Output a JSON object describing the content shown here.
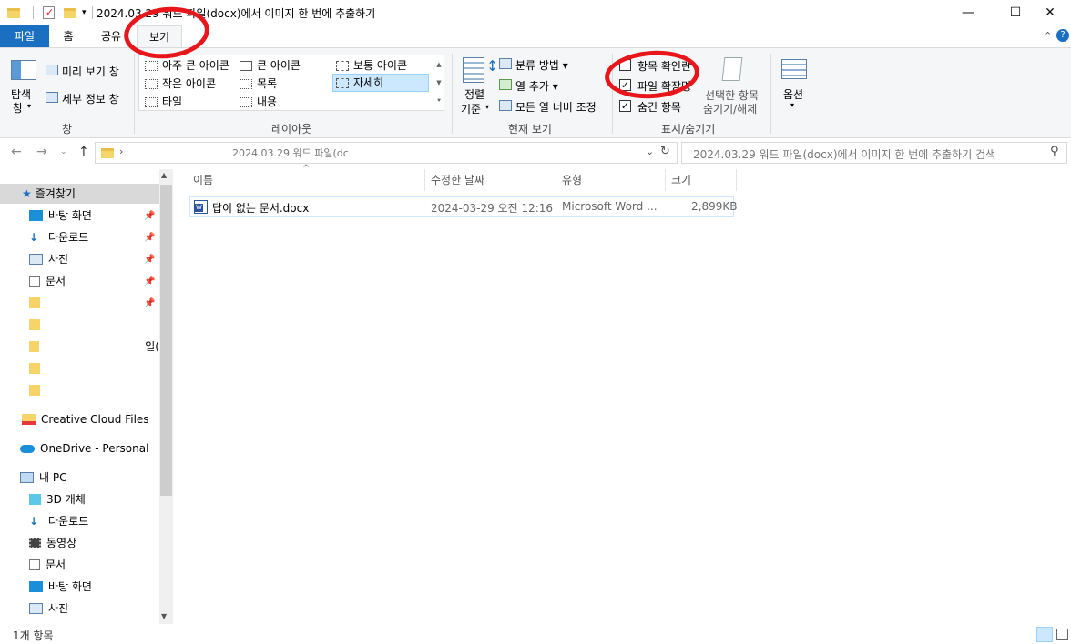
{
  "window": {
    "title": "2024.03.29 워드 파일(docx)에서 이미지 한 번에 추출하기",
    "controls": {
      "minimize": "—",
      "maximize": "☐",
      "close": "✕"
    }
  },
  "ribbon_tabs": [
    "파일",
    "홈",
    "공유",
    "보기"
  ],
  "ribbon": {
    "pane": {
      "nav_pane_line1": "탐색",
      "nav_pane_line2": "창",
      "preview": "미리 보기 창",
      "details_pane": "세부 정보 창",
      "label": "창"
    },
    "layout": {
      "items": [
        "아주 큰 아이콘",
        "큰 아이콘",
        "보통 아이콘",
        "작은 아이콘",
        "목록",
        "자세히",
        "타일",
        "내용"
      ],
      "selected": "자세히",
      "label": "레이아웃"
    },
    "current_view": {
      "sort_line1": "정렬",
      "sort_line2": "기준",
      "group_by": "분류 방법",
      "add_column": "열 추가",
      "fit_columns": "모든 열 너비 조정",
      "label": "현재 보기"
    },
    "show_hide": {
      "item_checkboxes": "항목 확인란",
      "file_extensions": "파일 확장명",
      "hidden_items": "숨긴 항목",
      "hide_selected_line1": "선택한 항목",
      "hide_selected_line2": "숨기기/해제",
      "label": "표시/숨기기",
      "item_checkboxes_checked": false,
      "file_extensions_checked": true,
      "hidden_items_checked": true
    },
    "options": {
      "label": "옵션"
    }
  },
  "address": {
    "path_visible": "2024.03.29 워드 파일(dc",
    "search_placeholder": "2024.03.29 워드 파일(docx)에서 이미지 한 번에 추출하기 검색"
  },
  "nav_pane": {
    "quick_access": "즐겨찾기",
    "quick_items": [
      "바탕 화면",
      "다운로드",
      "사진",
      "문서"
    ],
    "obscured_items": [
      "",
      "",
      "일(",
      "",
      ""
    ],
    "creative_cloud": "Creative Cloud Files",
    "onedrive": "OneDrive - Personal",
    "this_pc": "내 PC",
    "pc_items": [
      "3D 개체",
      "다운로드",
      "동영상",
      "문서",
      "바탕 화면",
      "사진"
    ]
  },
  "columns": [
    "이름",
    "수정한 날짜",
    "유형",
    "크기"
  ],
  "files": [
    {
      "name": "답이 없는 문서.docx",
      "modified": "2024-03-29 오전 12:16",
      "type": "Microsoft Word ...",
      "size": "2,899KB"
    }
  ],
  "status": {
    "count": "1개 항목"
  },
  "colors": {
    "file_tab": "#1a6fc0",
    "annotation": "#e8161b",
    "selection": "#cde8ff"
  }
}
